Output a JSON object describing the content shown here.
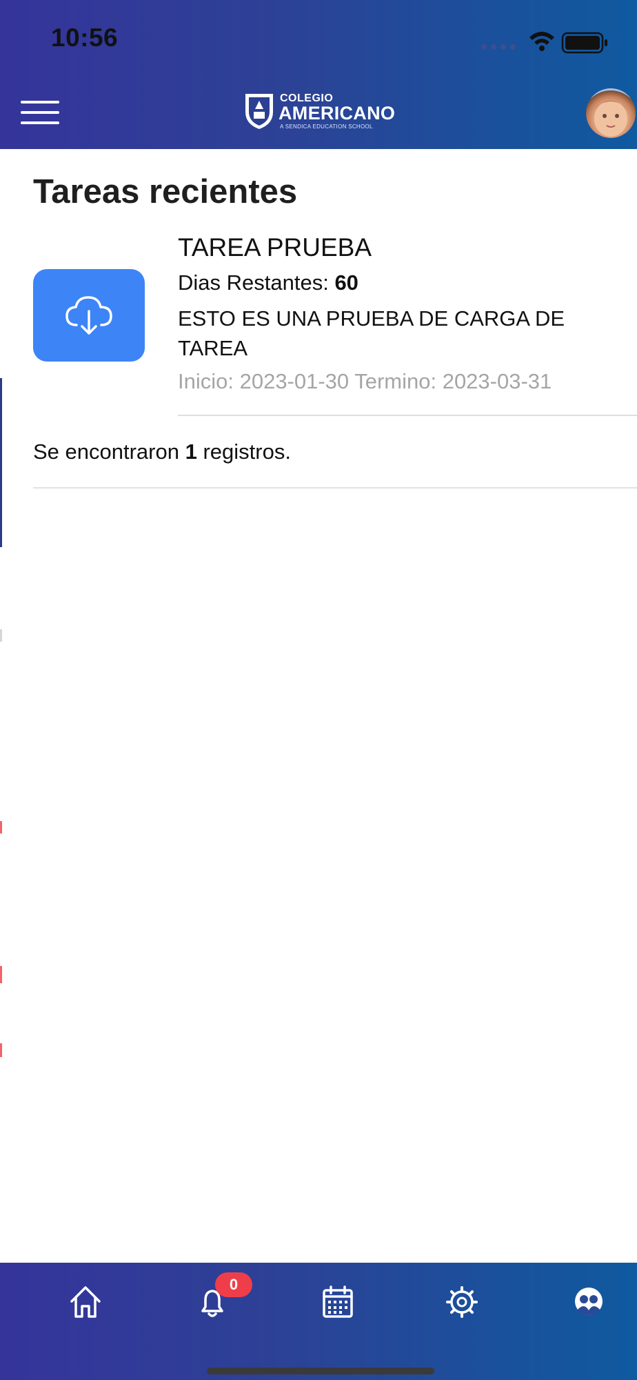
{
  "status_bar": {
    "time": "10:56"
  },
  "header": {
    "logo": {
      "line1": "COLEGIO",
      "line2": "AMERICANO",
      "tagline": "A SENDICA EDUCATION SCHOOL"
    }
  },
  "page": {
    "title": "Tareas recientes"
  },
  "tasks": [
    {
      "name": "TAREA PRUEBA",
      "days_label": "Dias Restantes: ",
      "days_value": "60",
      "description": "ESTO ES UNA PRUEBA DE CARGA DE TAREA",
      "dates": "Inicio: 2023-01-30 Termino: 2023-03-31",
      "icon": "cloud-download-icon"
    }
  ],
  "records": {
    "prefix": "Se encontraron ",
    "count": "1",
    "suffix": " registros."
  },
  "tabbar": {
    "notification_badge": "0",
    "items": [
      "home-icon",
      "bell-icon",
      "calendar-icon",
      "gear-icon",
      "users-icon"
    ]
  },
  "colors": {
    "header_start": "#35349a",
    "header_end": "#0f5aa0",
    "accent": "#3d84f7",
    "badge": "#ef3e4a",
    "muted_text": "#a5a5a5"
  }
}
